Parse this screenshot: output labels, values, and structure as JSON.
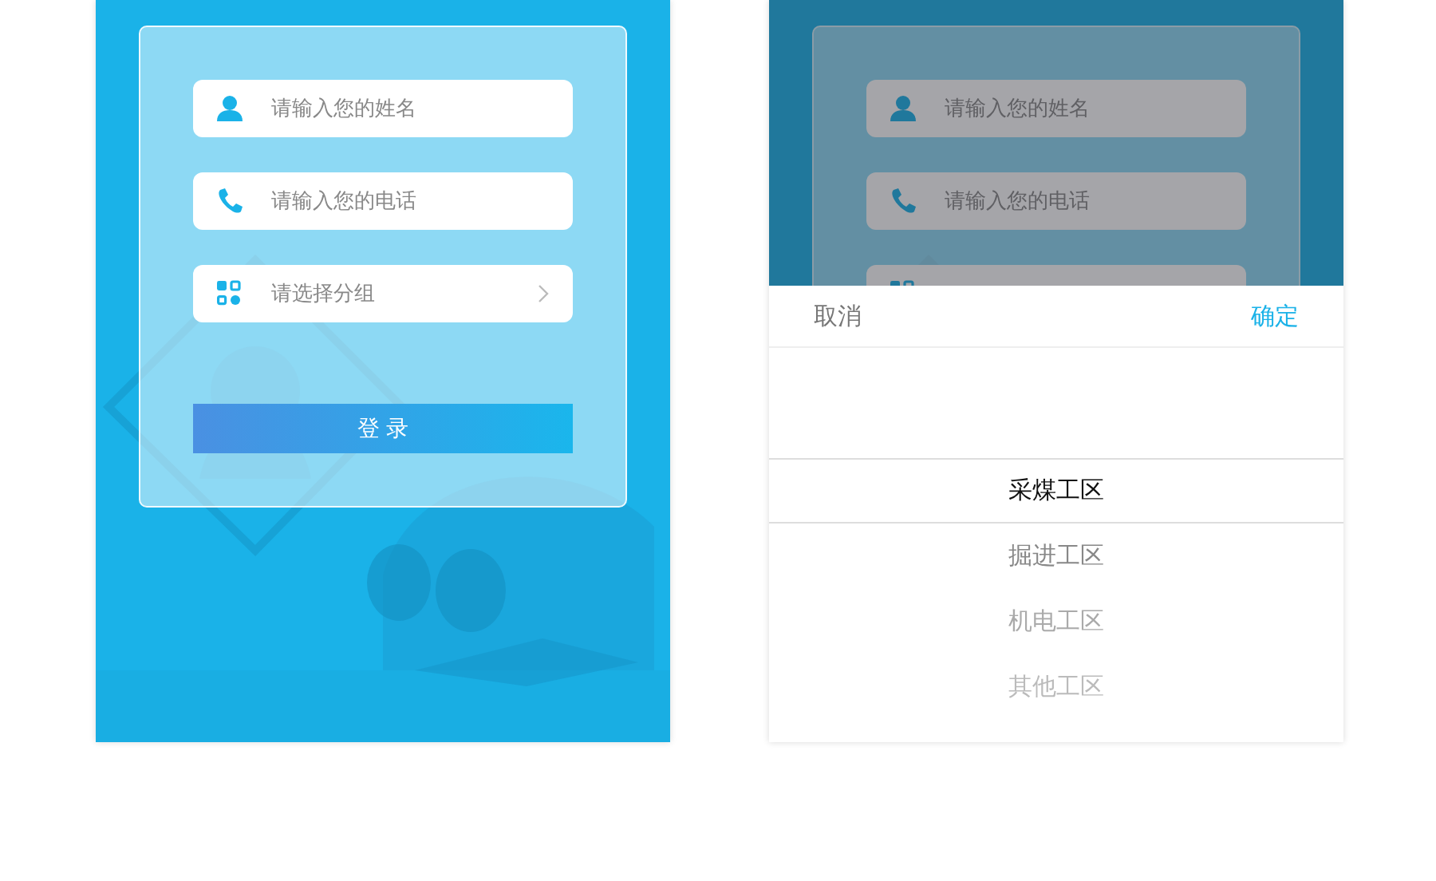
{
  "screens": [
    {
      "dimmed": false,
      "fields": [
        {
          "kind": "text",
          "placeholder": "请输入您的姓名"
        },
        {
          "kind": "text",
          "placeholder": "请输入您的电话"
        },
        {
          "kind": "select",
          "placeholder": "请选择分组"
        }
      ],
      "login_button": "登 录"
    },
    {
      "dimmed": true,
      "fields": [
        {
          "kind": "text",
          "placeholder": "请输入您的姓名"
        },
        {
          "kind": "text",
          "placeholder": "请输入您的电话"
        },
        {
          "kind": "covered"
        }
      ],
      "picker": {
        "cancel": "取消",
        "confirm": "确定",
        "options": [
          {
            "label": "采煤工区",
            "selected": true
          },
          {
            "label": "掘进工区",
            "selected": false
          },
          {
            "label": "机电工区",
            "selected": false
          },
          {
            "label": "其他工区",
            "selected": false
          }
        ]
      }
    }
  ]
}
